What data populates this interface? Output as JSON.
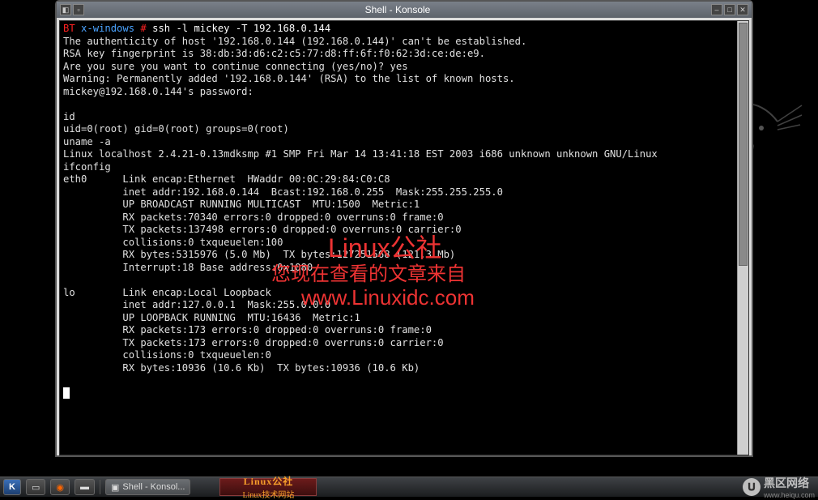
{
  "window": {
    "title": "Shell - Konsole"
  },
  "terminal": {
    "prompt_host": "BT",
    "prompt_dir": "x-windows",
    "prompt_hash": "#",
    "command": "ssh -l mickey -T 192.168.0.144",
    "lines": {
      "l2": "The authenticity of host '192.168.0.144 (192.168.0.144)' can't be established.",
      "l3": "RSA key fingerprint is 38:db:3d:d6:c2:c5:77:d8:ff:6f:f0:62:3d:ce:de:e9.",
      "l4": "Are you sure you want to continue connecting (yes/no)? yes",
      "l5": "Warning: Permanently added '192.168.0.144' (RSA) to the list of known hosts.",
      "l6": "mickey@192.168.0.144's password:",
      "l7": "",
      "l8": "id",
      "l9": "uid=0(root) gid=0(root) groups=0(root)",
      "l10": "uname -a",
      "l11": "Linux localhost 2.4.21-0.13mdksmp #1 SMP Fri Mar 14 13:41:18 EST 2003 i686 unknown unknown GNU/Linux",
      "l12": "ifconfig",
      "l13": "eth0      Link encap:Ethernet  HWaddr 00:0C:29:84:C0:C8",
      "l14": "          inet addr:192.168.0.144  Bcast:192.168.0.255  Mask:255.255.255.0",
      "l15": "          UP BROADCAST RUNNING MULTICAST  MTU:1500  Metric:1",
      "l16": "          RX packets:70340 errors:0 dropped:0 overruns:0 frame:0",
      "l17": "          TX packets:137498 errors:0 dropped:0 overruns:0 carrier:0",
      "l18": "          collisions:0 txqueuelen:100",
      "l19": "          RX bytes:5315976 (5.0 Mb)  TX bytes:127251568 (121.3 Mb)",
      "l20": "          Interrupt:18 Base address:0x1080",
      "l21": "",
      "l22": "lo        Link encap:Local Loopback",
      "l23": "          inet addr:127.0.0.1  Mask:255.0.0.0",
      "l24": "          UP LOOPBACK RUNNING  MTU:16436  Metric:1",
      "l25": "          RX packets:173 errors:0 dropped:0 overruns:0 frame:0",
      "l26": "          TX packets:173 errors:0 dropped:0 overruns:0 carrier:0",
      "l27": "          collisions:0 txqueuelen:0",
      "l28": "          RX bytes:10936 (10.6 Kb)  TX bytes:10936 (10.6 Kb)"
    }
  },
  "watermark": {
    "line1": "Linux公社",
    "line2": "您现在查看的文章来自",
    "line3": "www.Linuxidc.com"
  },
  "taskbar": {
    "task1": "Shell - Konsol...",
    "logo1_big": "Linux公社",
    "logo1_small": "Linux技术网站",
    "logo2_main": "黑区网络",
    "logo2_sub": "www.heiqu.com"
  }
}
